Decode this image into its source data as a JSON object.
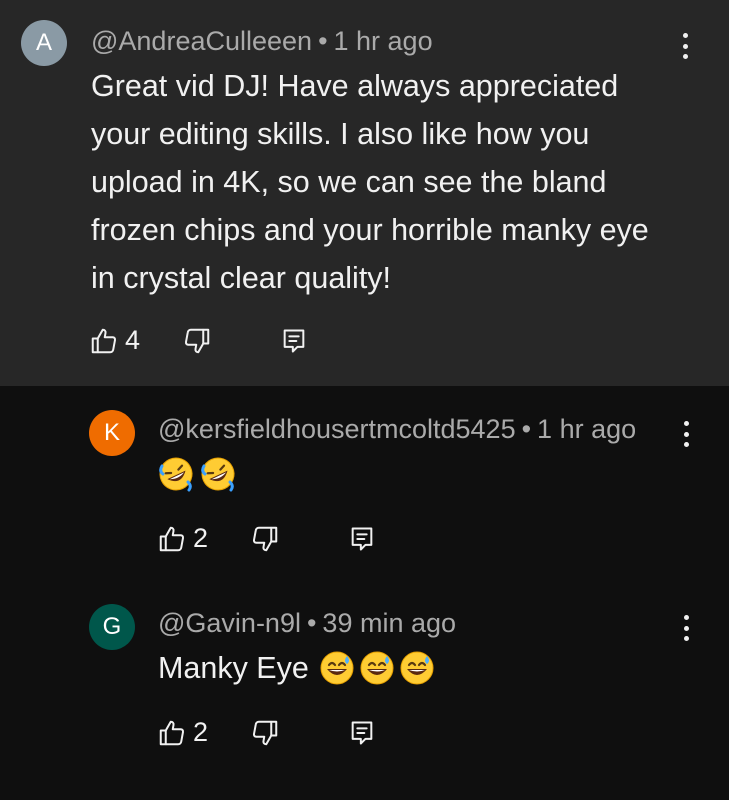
{
  "comments": [
    {
      "avatar_letter": "A",
      "avatar_color": "#8a9aa5",
      "username": "@AndreaCulleeen",
      "separator": "•",
      "time": "1 hr ago",
      "text_lines": [
        "Great vid DJ! Have always appreciated",
        "your editing skills. I also like how you",
        "upload in 4K, so we can see the bland",
        "frozen chips and your horrible manky eye",
        "in crystal clear quality!"
      ],
      "likes": "4"
    }
  ],
  "replies": [
    {
      "avatar_letter": "K",
      "avatar_color": "#ef6c00",
      "username": "@kersfieldhousertmcoltd5425",
      "separator": "•",
      "time": "1 hr ago",
      "text": "",
      "emojis": [
        "rolling-on-floor-laughing",
        "rolling-on-floor-laughing"
      ],
      "likes": "2"
    },
    {
      "avatar_letter": "G",
      "avatar_color": "#00574b",
      "username": "@Gavin-n9l",
      "separator": "•",
      "time": "39 min ago",
      "text": "Manky Eye",
      "emojis": [
        "grinning-face-with-sweat",
        "grinning-face-with-sweat",
        "grinning-face-with-sweat"
      ],
      "likes": "2"
    }
  ],
  "icons": {
    "like": "thumbs-up-icon",
    "dislike": "thumbs-down-icon",
    "reply": "reply-comment-icon",
    "more": "more-vertical-icon"
  },
  "colors": {
    "main_background": "#272727",
    "page_background": "#0f0f0f",
    "meta_text": "#aaaaaa",
    "primary_text": "#f1f1f1"
  }
}
